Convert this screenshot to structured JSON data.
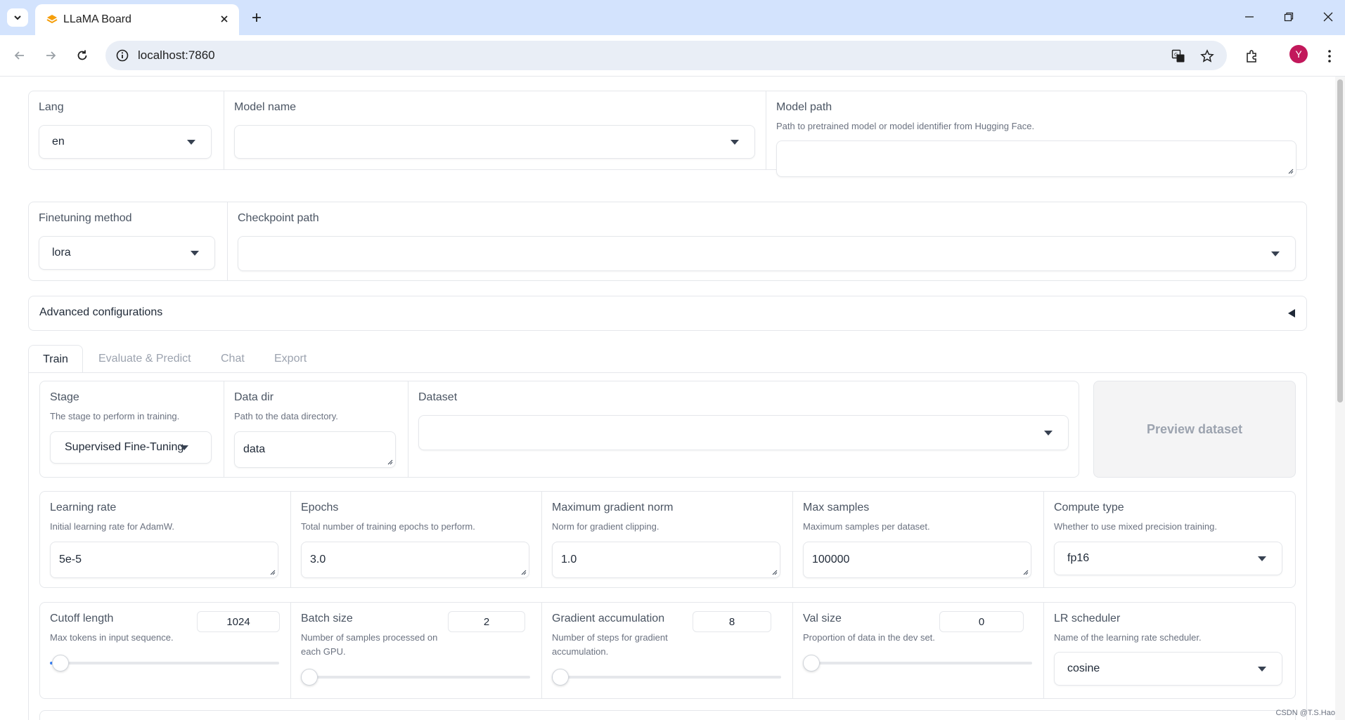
{
  "browser": {
    "tab_title": "LLaMA Board",
    "url": "localhost:7860",
    "avatar_letter": "Y"
  },
  "top": {
    "lang": {
      "label": "Lang",
      "value": "en"
    },
    "model_name": {
      "label": "Model name",
      "value": ""
    },
    "model_path": {
      "label": "Model path",
      "info": "Path to pretrained model or model identifier from Hugging Face.",
      "value": ""
    }
  },
  "method": {
    "finetuning": {
      "label": "Finetuning method",
      "value": "lora"
    },
    "checkpoint": {
      "label": "Checkpoint path",
      "value": ""
    }
  },
  "advanced": {
    "label": "Advanced configurations"
  },
  "tabs": [
    {
      "label": "Train"
    },
    {
      "label": "Evaluate & Predict"
    },
    {
      "label": "Chat"
    },
    {
      "label": "Export"
    }
  ],
  "train": {
    "stage": {
      "label": "Stage",
      "info": "The stage to perform in training.",
      "value": "Supervised Fine-Tuning"
    },
    "data_dir": {
      "label": "Data dir",
      "info": "Path to the data directory.",
      "value": "data"
    },
    "dataset": {
      "label": "Dataset",
      "value": ""
    },
    "preview_button": "Preview dataset",
    "learning_rate": {
      "label": "Learning rate",
      "info": "Initial learning rate for AdamW.",
      "value": "5e-5"
    },
    "epochs": {
      "label": "Epochs",
      "info": "Total number of training epochs to perform.",
      "value": "3.0"
    },
    "max_grad_norm": {
      "label": "Maximum gradient norm",
      "info": "Norm for gradient clipping.",
      "value": "1.0"
    },
    "max_samples": {
      "label": "Max samples",
      "info": "Maximum samples per dataset.",
      "value": "100000"
    },
    "compute_type": {
      "label": "Compute type",
      "info": "Whether to use mixed precision training.",
      "value": "fp16"
    },
    "cutoff_len": {
      "label": "Cutoff length",
      "info": "Max tokens in input sequence.",
      "value": "1024",
      "slider_fraction": 0.02
    },
    "batch_size": {
      "label": "Batch size",
      "info": "Number of samples processed on each GPU.",
      "value": "2",
      "slider_fraction": 0.0
    },
    "grad_accum": {
      "label": "Gradient accumulation",
      "info": "Number of steps for gradient accumulation.",
      "value": "8",
      "slider_fraction": 0.01
    },
    "val_size": {
      "label": "Val size",
      "info": "Proportion of data in the dev set.",
      "value": "0",
      "slider_fraction": 0.0
    },
    "lr_scheduler": {
      "label": "LR scheduler",
      "info": "Name of the learning rate scheduler.",
      "value": "cosine"
    }
  },
  "watermark": "CSDN @T.S.Hao",
  "colors": {
    "accent": "#3b82f6",
    "tabbar": "#d3e3fd",
    "avatar": "#c2185b"
  }
}
